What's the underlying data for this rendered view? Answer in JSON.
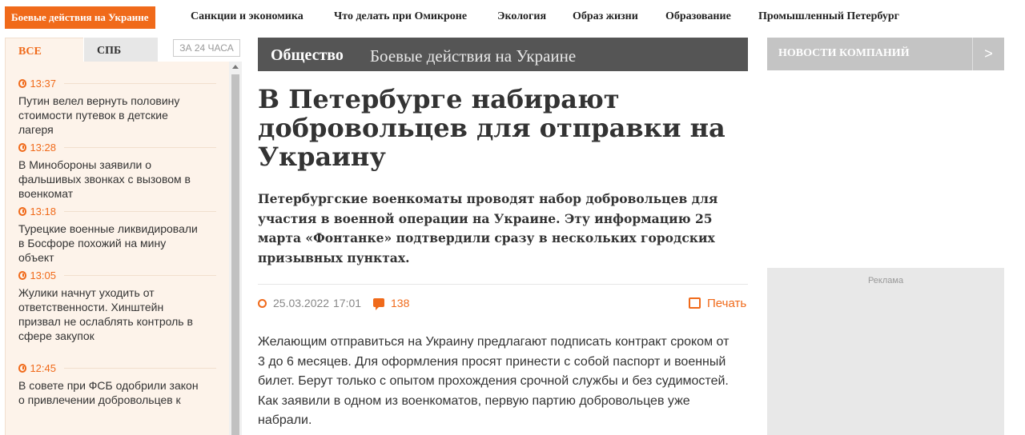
{
  "topnav": {
    "active": "Боевые действия на Украине",
    "items": [
      "Санкции и экономика",
      "Что делать при Омикроне",
      "Экология",
      "Образ жизни",
      "Образование",
      "Промышленный Петербург"
    ]
  },
  "feed": {
    "tabs": {
      "all": "ВСЕ",
      "spb": "СПБ",
      "period": "ЗА 24 ЧАСА"
    },
    "items": [
      {
        "time": "13:37",
        "title": "Путин велел вернуть половину стоимости путевок в детские лагеря"
      },
      {
        "time": "13:28",
        "title": "В Минобороны заявили о фальшивых звонках с вызовом в военкомат"
      },
      {
        "time": "13:18",
        "title": "Турецкие военные ликвидировали в Босфоре похожий на мину объект"
      },
      {
        "time": "13:05",
        "title": "Жулики начнут уходить от ответственности. Хинштейн призвал не ослаблять контроль в сфере закупок"
      },
      {
        "time": "12:45",
        "title": "В совете при ФСБ одобрили закон о привлечении добровольцев к"
      }
    ]
  },
  "article": {
    "section": "Общество",
    "subsection": "Боевые действия на Украине",
    "headline": "В Петербурге набирают добровольцев для отправки на Украину",
    "lead": "Петербургские военкоматы проводят набор добровольцев для участия в военной операции на Украине. Эту информацию 25 марта «Фонтанке» подтвердили сразу в нескольких городских призывных пунктах.",
    "date": "25.03.2022",
    "time": "17:01",
    "comments": "138",
    "print": "Печать",
    "body": "Желающим отправиться на Украину предлагают подписать контракт сроком от 3 до 6 месяцев. Для оформления просят принести с собой паспорт и военный билет. Берут только с опытом прохождения срочной службы и без судимостей. Как заявили в одном из военкоматов, первую партию добровольцев уже набрали."
  },
  "sidebar": {
    "news_companies": "НОВОСТИ КОМПАНИЙ",
    "next": ">",
    "ad_label": "Реклама"
  },
  "colors": {
    "accent": "#f06a1a",
    "section_bar": "#555555",
    "feed_bg": "#fdf3ea"
  }
}
